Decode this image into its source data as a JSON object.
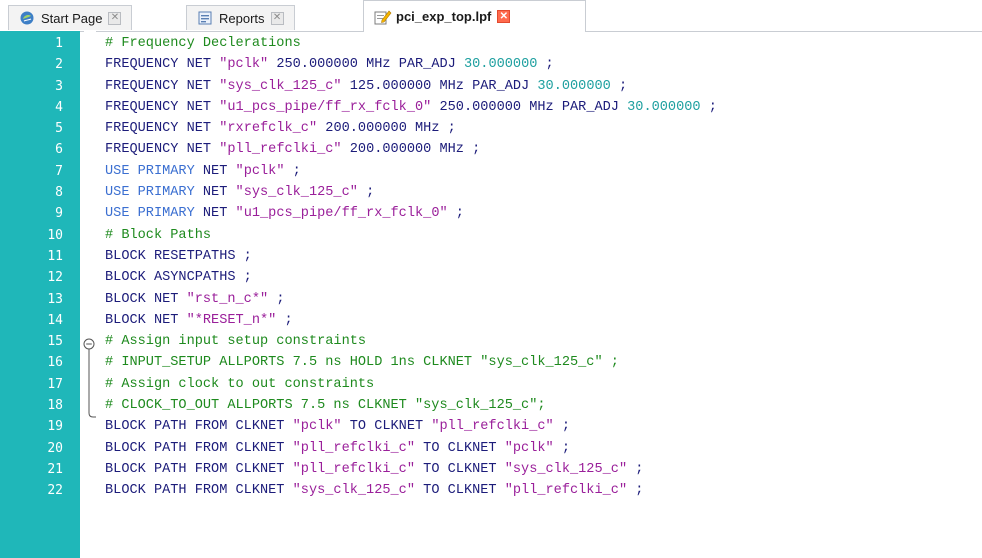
{
  "tabs": [
    {
      "label": "Start Page",
      "icon": "start-page-icon"
    },
    {
      "label": "Reports",
      "icon": "reports-icon"
    },
    {
      "label": "pci_exp_top.lpf",
      "icon": "edit-file-icon"
    }
  ],
  "close_glyph": "✕",
  "colors": {
    "gutter": "#1fb7b9",
    "comment": "#1e8a1e",
    "keyword": "#1c1c7a",
    "keyword_primary": "#3b6fd1",
    "string": "#9a1f9a",
    "number": "#1fa0a0"
  },
  "lines": [
    {
      "n": "1",
      "parts": [
        {
          "t": "# Frequency Declerations",
          "c": "cm"
        }
      ]
    },
    {
      "n": "2",
      "parts": [
        {
          "t": "FREQUENCY NET ",
          "c": "kw"
        },
        {
          "t": "\"pclk\"",
          "c": "st"
        },
        {
          "t": " 250.000000",
          "c": "kw"
        },
        {
          "t": " MHz PAR_ADJ ",
          "c": "kw"
        },
        {
          "t": "30.000000",
          "c": "nm"
        },
        {
          "t": " ;",
          "c": "op"
        }
      ]
    },
    {
      "n": "3",
      "parts": [
        {
          "t": "FREQUENCY NET ",
          "c": "kw"
        },
        {
          "t": "\"sys_clk_125_c\"",
          "c": "st"
        },
        {
          "t": " 125.000000",
          "c": "kw"
        },
        {
          "t": " MHz PAR_ADJ ",
          "c": "kw"
        },
        {
          "t": "30.000000",
          "c": "nm"
        },
        {
          "t": " ;",
          "c": "op"
        }
      ]
    },
    {
      "n": "4",
      "parts": [
        {
          "t": "FREQUENCY NET ",
          "c": "kw"
        },
        {
          "t": "\"u1_pcs_pipe/ff_rx_fclk_0\"",
          "c": "st"
        },
        {
          "t": " 250.000000",
          "c": "kw"
        },
        {
          "t": " MHz PAR_ADJ ",
          "c": "kw"
        },
        {
          "t": "30.000000",
          "c": "nm"
        },
        {
          "t": " ;",
          "c": "op"
        }
      ]
    },
    {
      "n": "5",
      "parts": [
        {
          "t": "FREQUENCY NET ",
          "c": "kw"
        },
        {
          "t": "\"rxrefclk_c\"",
          "c": "st"
        },
        {
          "t": " 200.000000",
          "c": "kw"
        },
        {
          "t": " MHz ;",
          "c": "kw"
        }
      ]
    },
    {
      "n": "6",
      "parts": [
        {
          "t": "FREQUENCY NET ",
          "c": "kw"
        },
        {
          "t": "\"pll_refclki_c\"",
          "c": "st"
        },
        {
          "t": " 200.000000",
          "c": "kw"
        },
        {
          "t": " MHz ;",
          "c": "kw"
        }
      ]
    },
    {
      "n": "7",
      "parts": [
        {
          "t": "USE PRIMARY",
          "c": "kwp"
        },
        {
          "t": " NET ",
          "c": "kw"
        },
        {
          "t": "\"pclk\"",
          "c": "st"
        },
        {
          "t": " ;",
          "c": "op"
        }
      ]
    },
    {
      "n": "8",
      "parts": [
        {
          "t": "USE PRIMARY",
          "c": "kwp"
        },
        {
          "t": " NET ",
          "c": "kw"
        },
        {
          "t": "\"sys_clk_125_c\"",
          "c": "st"
        },
        {
          "t": " ;",
          "c": "op"
        }
      ]
    },
    {
      "n": "9",
      "parts": [
        {
          "t": "USE PRIMARY",
          "c": "kwp"
        },
        {
          "t": " NET ",
          "c": "kw"
        },
        {
          "t": "\"u1_pcs_pipe/ff_rx_fclk_0\"",
          "c": "st"
        },
        {
          "t": " ;",
          "c": "op"
        }
      ]
    },
    {
      "n": "10",
      "parts": [
        {
          "t": "# Block Paths",
          "c": "cm"
        }
      ]
    },
    {
      "n": "11",
      "parts": [
        {
          "t": "BLOCK RESETPATHS ;",
          "c": "kw"
        }
      ]
    },
    {
      "n": "12",
      "parts": [
        {
          "t": "BLOCK ASYNCPATHS ;",
          "c": "kw"
        }
      ]
    },
    {
      "n": "13",
      "parts": [
        {
          "t": "BLOCK NET ",
          "c": "kw"
        },
        {
          "t": "\"rst_n_c*\"",
          "c": "st"
        },
        {
          "t": " ;",
          "c": "op"
        }
      ]
    },
    {
      "n": "14",
      "parts": [
        {
          "t": "BLOCK NET ",
          "c": "kw"
        },
        {
          "t": "\"*RESET_n*\"",
          "c": "st"
        },
        {
          "t": " ;",
          "c": "op"
        }
      ]
    },
    {
      "n": "15",
      "parts": [
        {
          "t": "# Assign input setup constraints",
          "c": "cm"
        }
      ]
    },
    {
      "n": "16",
      "parts": [
        {
          "t": "# INPUT_SETUP ALLPORTS 7.5 ns HOLD 1ns CLKNET \"sys_clk_125_c\" ;",
          "c": "cm"
        }
      ]
    },
    {
      "n": "17",
      "parts": [
        {
          "t": "# Assign clock to out constraints",
          "c": "cm"
        }
      ]
    },
    {
      "n": "18",
      "parts": [
        {
          "t": "# CLOCK_TO_OUT ALLPORTS 7.5 ns CLKNET \"sys_clk_125_c\";",
          "c": "cm"
        }
      ]
    },
    {
      "n": "19",
      "parts": [
        {
          "t": "BLOCK PATH FROM CLKNET ",
          "c": "kw"
        },
        {
          "t": "\"pclk\"",
          "c": "st"
        },
        {
          "t": " TO CLKNET ",
          "c": "kw"
        },
        {
          "t": "\"pll_refclki_c\"",
          "c": "st"
        },
        {
          "t": " ;",
          "c": "op"
        }
      ]
    },
    {
      "n": "20",
      "parts": [
        {
          "t": "BLOCK PATH FROM CLKNET ",
          "c": "kw"
        },
        {
          "t": "\"pll_refclki_c\"",
          "c": "st"
        },
        {
          "t": " TO CLKNET ",
          "c": "kw"
        },
        {
          "t": "\"pclk\"",
          "c": "st"
        },
        {
          "t": " ;",
          "c": "op"
        }
      ]
    },
    {
      "n": "21",
      "parts": [
        {
          "t": "BLOCK PATH FROM CLKNET ",
          "c": "kw"
        },
        {
          "t": "\"pll_refclki_c\"",
          "c": "st"
        },
        {
          "t": " TO CLKNET ",
          "c": "kw"
        },
        {
          "t": "\"sys_clk_125_c\"",
          "c": "st"
        },
        {
          "t": " ;",
          "c": "op"
        }
      ]
    },
    {
      "n": "22",
      "parts": [
        {
          "t": "BLOCK PATH FROM CLKNET ",
          "c": "kw"
        },
        {
          "t": "\"sys_clk_125_c\"",
          "c": "st"
        },
        {
          "t": " TO CLKNET ",
          "c": "kw"
        },
        {
          "t": "\"pll_refclki_c\"",
          "c": "st"
        },
        {
          "t": " ;",
          "c": "op"
        }
      ]
    }
  ],
  "fold": {
    "start_line": "15",
    "end_line": "18",
    "glyph": "−"
  }
}
